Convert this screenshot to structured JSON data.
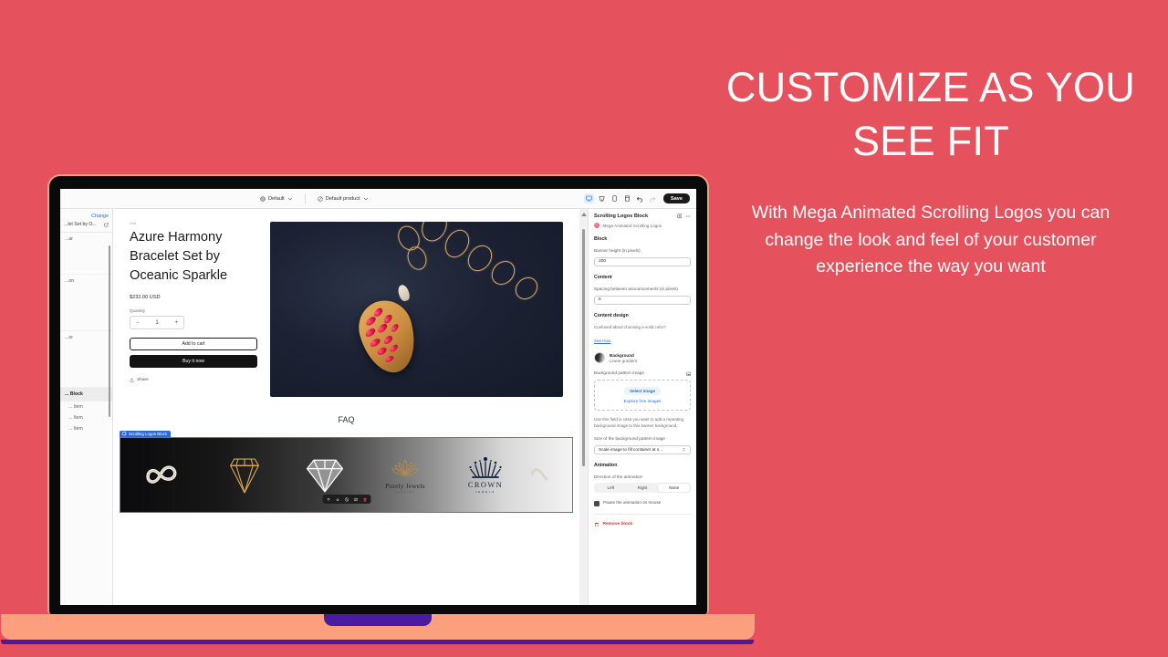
{
  "promo": {
    "headline": "CUSTOMIZE AS YOU SEE FIT",
    "subtext": "With Mega Animated Scrolling Logos you can change the look and feel of your customer experience the way you want"
  },
  "colors": {
    "background": "#e5525e",
    "laptop_base": "#fb9f7f",
    "laptop_accent": "#4b1b9e",
    "bezel": "#0a0a0a",
    "accent_link": "#2f6ecf",
    "block_label": "#2e68d6",
    "danger": "#c0392b"
  },
  "editor": {
    "topbar": {
      "theme_selector": "Default",
      "template_selector": "Default product",
      "save_label": "Save",
      "device_icons": [
        "desktop-icon",
        "mobile-icon",
        "tablet-icon",
        "fullscreen-icon"
      ],
      "undo_icon": "undo-icon",
      "redo_icon": "redo-icon"
    },
    "left_rail": {
      "change_label": "Change",
      "product_label": "...let Set by O...",
      "rows": [
        "...ar",
        "...on",
        "...or"
      ],
      "selected_section": "... Block",
      "sub_items": [
        "... Item",
        "... Item",
        "... Item"
      ]
    },
    "canvas": {
      "product": {
        "vendor": "Vivi",
        "title": "Azure Harmony Bracelet Set by Oceanic Sparkle",
        "price": "$232.00 USD",
        "quantity_label": "Quantity",
        "quantity_value": "1",
        "decrement": "−",
        "increment": "+",
        "add_to_cart": "Add to cart",
        "buy_it_now": "Buy it now",
        "share": "Share"
      },
      "faq_heading": "FAQ",
      "block_label": "Scrolling Logos Block",
      "logos": [
        {
          "name": "infinity-ribbon-logo"
        },
        {
          "name": "gold-diamond-logo"
        },
        {
          "name": "silver-diamond-logo"
        },
        {
          "name": "purely-jewels-logo",
          "line1": "Purely Jewels",
          "line2": "JEWELRY"
        },
        {
          "name": "crown-jewels-logo",
          "line1": "CROWN",
          "line2": "JEWELS"
        }
      ],
      "block_toolbar_icons": [
        "move-up-icon",
        "move-down-icon",
        "hide-icon",
        "duplicate-icon",
        "delete-icon"
      ]
    },
    "settings": {
      "panel_title": "Scrolling Logos Block",
      "app_name": "Mega Animated Scrolling Logos",
      "header_icons": [
        "visibility-icon",
        "more-options-icon"
      ],
      "block_section": "Block",
      "banner_height_label": "Banner height (in pixels)",
      "banner_height_value": "200",
      "content_section": "Content",
      "spacing_label": "Spacing between announcements (in pixels)",
      "spacing_value": "5",
      "content_design_section": "Content design",
      "solid_color_help": "Confused about choosing a solid color?",
      "see_how_link": "See How",
      "background_title": "Background",
      "background_value": "Linear gradient",
      "pattern_image_label": "Background pattern image",
      "select_image_button": "Select image",
      "explore_free_images": "Explore free images",
      "pattern_help": "Use this field in case you want to add a repeating background image to this banner background.",
      "pattern_size_label": "Size of the background pattern image",
      "pattern_size_value": "Scale image to fill container at s...",
      "animation_section": "Animation",
      "direction_label": "Direction of the animation",
      "direction_options": [
        "Left",
        "Right",
        "None"
      ],
      "direction_selected": "None",
      "pause_label": "Pause the animation on mouse",
      "pause_checked": true,
      "remove_block": "Remove block"
    }
  }
}
